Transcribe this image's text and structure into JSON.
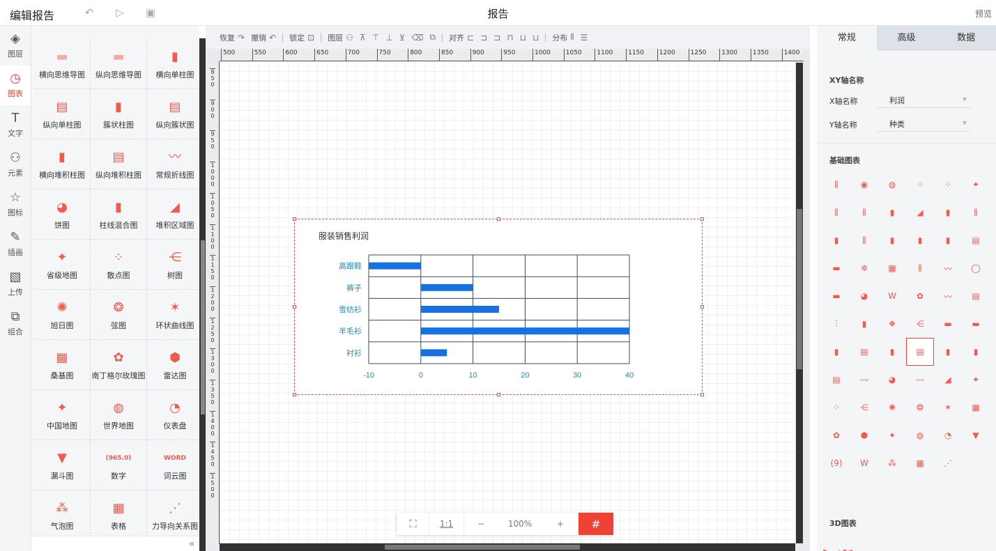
{
  "topbar": {
    "title": "编辑报告",
    "report_name": "报告",
    "preview": "预览",
    "undo_icon": "undo-icon",
    "play_icon": "play-icon",
    "save_icon": "save-icon"
  },
  "leftnav": {
    "items": [
      {
        "label": "图层",
        "icon": "layers-icon"
      },
      {
        "label": "图表",
        "icon": "chart-icon"
      },
      {
        "label": "文字",
        "icon": "text-icon"
      },
      {
        "label": "元素",
        "icon": "elements-icon"
      },
      {
        "label": "图标",
        "icon": "star-icon"
      },
      {
        "label": "插画",
        "icon": "palette-icon"
      },
      {
        "label": "上传",
        "icon": "upload-image-icon"
      },
      {
        "label": "组合",
        "icon": "group-icon"
      }
    ]
  },
  "palette": {
    "items": [
      {
        "label": "横向思维导图",
        "glyph": "▬"
      },
      {
        "label": "纵向思维导图",
        "glyph": "▬"
      },
      {
        "label": "横向单柱图",
        "glyph": "▮"
      },
      {
        "label": "纵向单柱图",
        "glyph": "▤"
      },
      {
        "label": "簇状柱图",
        "glyph": "▮"
      },
      {
        "label": "纵向簇状图",
        "glyph": "▤"
      },
      {
        "label": "横向堆积柱图",
        "glyph": "▮"
      },
      {
        "label": "纵向堆积柱图",
        "glyph": "▤"
      },
      {
        "label": "常规折线图",
        "glyph": "〰"
      },
      {
        "label": "饼图",
        "glyph": "◕"
      },
      {
        "label": "柱线混合图",
        "glyph": "▮"
      },
      {
        "label": "堆积区域图",
        "glyph": "◢"
      },
      {
        "label": "省级地图",
        "glyph": "✦"
      },
      {
        "label": "散点图",
        "glyph": "⁘"
      },
      {
        "label": "树图",
        "glyph": "⋲"
      },
      {
        "label": "旭日图",
        "glyph": "✺"
      },
      {
        "label": "弦图",
        "glyph": "❂"
      },
      {
        "label": "环状曲线图",
        "glyph": "✶"
      },
      {
        "label": "桑基图",
        "glyph": "▦"
      },
      {
        "label": "南丁格尔玫瑰图",
        "glyph": "✿"
      },
      {
        "label": "雷达图",
        "glyph": "⬢"
      },
      {
        "label": "中国地图",
        "glyph": "✦"
      },
      {
        "label": "世界地图",
        "glyph": "◍"
      },
      {
        "label": "仪表盘",
        "glyph": "◔"
      },
      {
        "label": "漏斗图",
        "glyph": "▼"
      },
      {
        "label": "数字",
        "glyph": "(965.0)"
      },
      {
        "label": "词云图",
        "glyph": "WORD"
      },
      {
        "label": "气泡图",
        "glyph": "⁂"
      },
      {
        "label": "表格",
        "glyph": "▦"
      },
      {
        "label": "力导向关系图",
        "glyph": "⋰"
      }
    ]
  },
  "edit_toolbar": {
    "redo": "恢复",
    "undo": "撤销",
    "lock": "锁定",
    "layer": "图层",
    "align": "对齐",
    "distribute": "分布"
  },
  "ruler": {
    "top_labels": [
      "500",
      "550",
      "600",
      "650",
      "700",
      "750",
      "800",
      "850",
      "900",
      "950",
      "1000",
      "1050",
      "1100",
      "1150",
      "1200",
      "1250",
      "1300",
      "1350",
      "1400"
    ],
    "left_labels": [
      "850",
      "900",
      "950",
      "1000",
      "1050",
      "1100",
      "1150",
      "1200",
      "1250",
      "1300",
      "1350",
      "1400",
      "1450",
      "1500"
    ]
  },
  "zoombar": {
    "fit_icon": "fit-screen-icon",
    "one_to_one": "1:1",
    "minus": "−",
    "zoom": "100%",
    "plus": "+",
    "grid_icon": "grid-icon"
  },
  "chart_data": {
    "type": "bar",
    "orientation": "horizontal",
    "title": "服装销售利润",
    "categories": [
      "高跟鞋",
      "裤子",
      "雪纺衫",
      "羊毛衫",
      "衬衫"
    ],
    "values": [
      -10,
      10,
      15,
      40,
      5
    ],
    "xlim": [
      -10,
      40
    ],
    "xticks": [
      -10,
      0,
      10,
      20,
      30,
      40
    ],
    "grid": true,
    "bar_color": "#1572e0",
    "label_color": "#1f8ab0"
  },
  "rpanel": {
    "tabs": [
      "常规",
      "高级",
      "数据"
    ],
    "xy_section": "XY轴名称",
    "x_label": "X轴名称",
    "x_value": "利润",
    "y_label": "Y轴名称",
    "y_value": "种类",
    "basic_section": "基础图表",
    "section_3d": "3D图表",
    "accent": "#f04134"
  }
}
